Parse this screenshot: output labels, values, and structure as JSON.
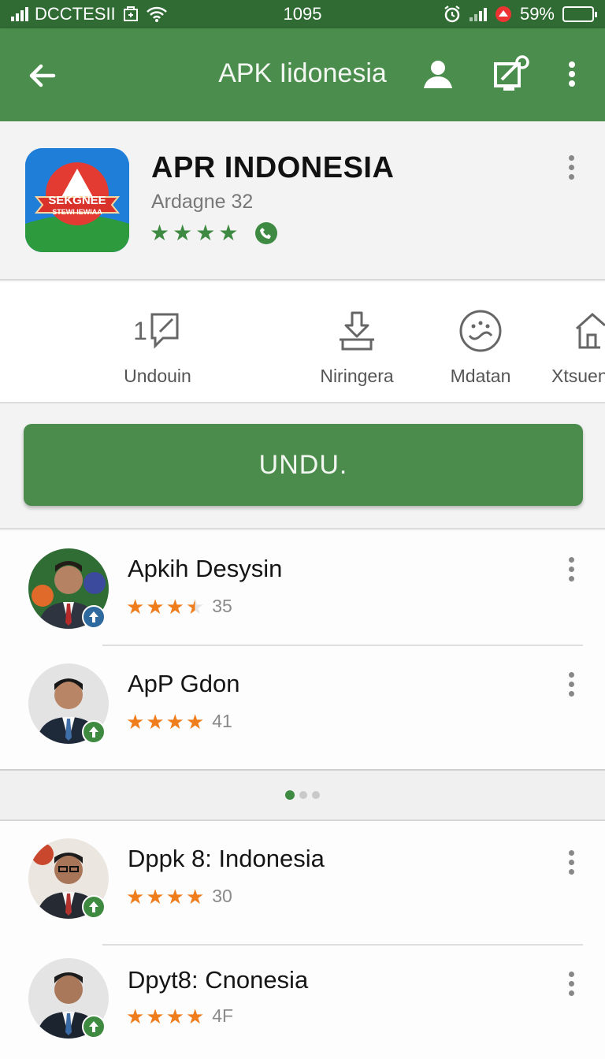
{
  "status": {
    "carrier": "DCCTESII",
    "time": "1095",
    "battery": "59%",
    "battery_level": 0.59
  },
  "app_bar": {
    "title": "APK Iidonesia"
  },
  "app": {
    "name": "APR INDONESIA",
    "developer": "Ardagne 32",
    "rating": 4,
    "icon_text_top": "SEKGNEE",
    "icon_text_bottom": "STEWI IEWIAA"
  },
  "quick_actions": [
    {
      "label": "Undouin",
      "icon": "comment-icon",
      "prefix": "1"
    },
    {
      "label": "Niringera",
      "icon": "download-icon"
    },
    {
      "label": "Mdatan",
      "icon": "face-icon"
    },
    {
      "label": "Xtsuen",
      "icon": "home-icon"
    }
  ],
  "install_button": {
    "label": "UNDU."
  },
  "apps": [
    {
      "name": "Apkih Desysin",
      "rating": 3.5,
      "count": "35",
      "badge_color": "#2f6a9e"
    },
    {
      "name": "ApP Gdon",
      "rating": 4,
      "count": "41",
      "badge_color": "#3e8a40"
    },
    {
      "name": "Dppk 8: Indonesia",
      "rating": 4,
      "count": "30",
      "badge_color": "#3e8a40"
    },
    {
      "name": "Dpyt8: Cnonesia",
      "rating": 4,
      "count": "4F",
      "badge_color": "#3e8a40"
    }
  ],
  "pager": {
    "pages": 3,
    "active": 0
  },
  "colors": {
    "primary": "#4b8d4c",
    "status_bar": "#2f6b33",
    "star_green": "#3f8a42",
    "star_orange": "#f07d1c"
  }
}
